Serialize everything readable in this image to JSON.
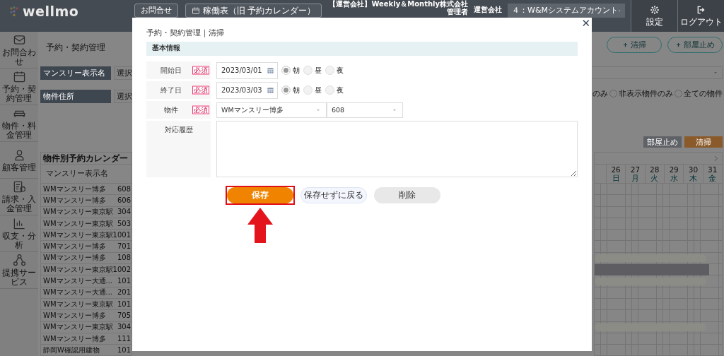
{
  "header": {
    "logo": "wellmo",
    "buttons": [
      "お問合せ",
      "稼働表（旧 予約カレンダー）"
    ],
    "company": "【運営会社】Weekly＆Monthly株式会社",
    "role": "管理者",
    "account_label": "運営会社",
    "account_select": "４：W&Mシステムアカウント",
    "actions": [
      "設定",
      "ログアウト"
    ]
  },
  "sidebar": {
    "items": [
      "お問合わせ",
      "予約・契約管理",
      "物件・料金管理",
      "顧客管理",
      "請求・入金管理",
      "収支・分析",
      "提携サービス"
    ]
  },
  "page": {
    "title": "予約・契約管理",
    "add_buttons": [
      "清掃",
      "部屋止め"
    ],
    "filters": [
      {
        "label": "マンスリー表示名",
        "placeholder": "選択"
      },
      {
        "label": "物件住所",
        "placeholder": "選択"
      }
    ],
    "partial_label": "のみ",
    "radio_options": [
      {
        "label": "非表示物件のみ",
        "selected": false
      },
      {
        "label": "全ての物件",
        "selected": false
      }
    ],
    "legend": [
      {
        "label": "部屋止め",
        "color": "#5e6166"
      },
      {
        "label": "清掃",
        "color": "#8a5a2a"
      }
    ]
  },
  "calendar": {
    "title": "物件別予約カレンダー",
    "name_column": "マンスリー表示名",
    "days": [
      {
        "date": "26",
        "weekday": "日"
      },
      {
        "date": "27",
        "weekday": "月"
      },
      {
        "date": "28",
        "weekday": "火"
      },
      {
        "date": "29",
        "weekday": "水"
      },
      {
        "date": "30",
        "weekday": "木"
      },
      {
        "date": "31",
        "weekday": "金"
      }
    ],
    "rows": [
      {
        "name": "WMマンスリー博多",
        "room": "608",
        "kind": "empty"
      },
      {
        "name": "WMマンスリー博多",
        "room": "606",
        "kind": "empty"
      },
      {
        "name": "WMマンスリー東京駅",
        "room": "304",
        "kind": "empty"
      },
      {
        "name": "WMマンスリー東京駅",
        "room": "503",
        "kind": "empty"
      },
      {
        "name": "WMマンスリー東京駅",
        "room": "1001",
        "kind": "empty"
      },
      {
        "name": "WMマンスリー博多",
        "room": "701",
        "kind": "empty"
      },
      {
        "name": "WMマンスリー博多",
        "room": "108",
        "kind": "stay"
      },
      {
        "name": "WMマンスリー東京駅",
        "room": "1002",
        "kind": "blocked"
      },
      {
        "name": "WMマンスリー大通...",
        "room": "101",
        "kind": "stay"
      },
      {
        "name": "WMマンスリー大通...",
        "room": "201",
        "kind": "empty"
      },
      {
        "name": "WMマンスリー東京駅",
        "room": "101",
        "kind": "empty"
      },
      {
        "name": "WMマンスリー博多",
        "room": "705",
        "kind": "empty"
      },
      {
        "name": "WMマンスリー東京駅",
        "room": "304",
        "kind": "stay"
      },
      {
        "name": "WMマンスリー博多",
        "room": "111",
        "kind": "empty"
      },
      {
        "name": "静岡W確認用建物",
        "room": "101",
        "kind": "empty"
      }
    ]
  },
  "modal": {
    "close": "✕",
    "title": "予約・契約管理｜清掃",
    "section": "基本情報",
    "fields": [
      {
        "kind": "date",
        "label": "開始日",
        "badge": "必須",
        "value": "2023/03/01",
        "slots": [
          {
            "label": "朝",
            "selected": true
          },
          {
            "label": "昼",
            "selected": false
          },
          {
            "label": "夜",
            "selected": false
          }
        ]
      },
      {
        "kind": "date",
        "label": "終了日",
        "badge": "必須",
        "value": "2023/03/03",
        "slots": [
          {
            "label": "朝",
            "selected": true
          },
          {
            "label": "昼",
            "selected": false
          },
          {
            "label": "夜",
            "selected": false
          }
        ]
      },
      {
        "kind": "select",
        "label": "物件",
        "badge": "必須",
        "selects": [
          "WMマンスリー博多",
          "608"
        ]
      },
      {
        "kind": "textarea",
        "label": "対応履歴"
      }
    ],
    "buttons": [
      {
        "label": "保存",
        "kind": "primary",
        "highlighted": true
      },
      {
        "label": "保存せずに戻る",
        "kind": "secondary",
        "highlighted": false
      },
      {
        "label": "削除",
        "kind": "muted",
        "highlighted": false
      }
    ]
  }
}
